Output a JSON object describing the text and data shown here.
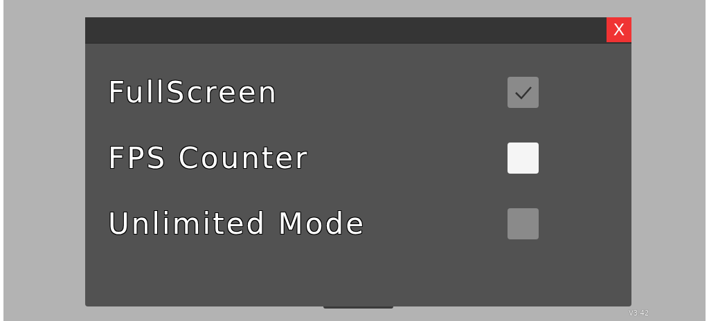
{
  "dialog": {
    "close_label": "X"
  },
  "options": [
    {
      "label": "FullScreen",
      "checked": true,
      "highlighted": false
    },
    {
      "label": "FPS Counter",
      "checked": false,
      "highlighted": true
    },
    {
      "label": "Unlimited Mode",
      "checked": false,
      "highlighted": false
    }
  ],
  "version": "V3.42"
}
